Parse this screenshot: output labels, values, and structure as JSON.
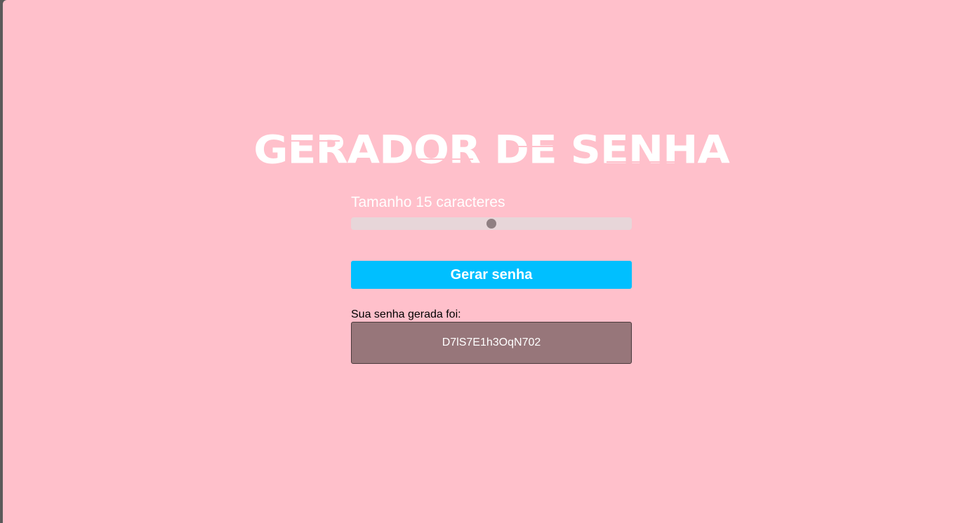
{
  "app": {
    "title": "GERADOR DE SENHA"
  },
  "length": {
    "label": "Tamanho 15 caracteres",
    "value": 15,
    "slider_fraction": 0.5
  },
  "generate_button": {
    "label": "Gerar senha"
  },
  "result": {
    "label": "Sua senha gerada foi:",
    "password": "D7lS7E1h3OqN702"
  },
  "colors": {
    "background": "#ffc0cb",
    "button": "#00bfff",
    "result_box": "#97767a"
  }
}
